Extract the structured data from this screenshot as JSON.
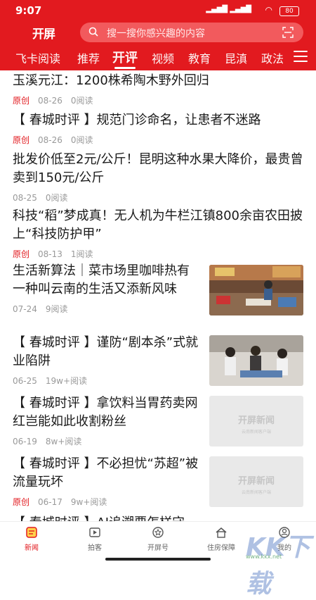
{
  "status": {
    "time": "9:07",
    "battery": "80"
  },
  "header": {
    "logo": "开屏",
    "search_placeholder": "搜一搜你感兴趣的内容"
  },
  "tabs": [
    "飞卡阅读",
    "推荐",
    "开评",
    "视频",
    "教育",
    "昆滇",
    "政法"
  ],
  "active_tab": "开评",
  "articles": [
    {
      "title": "玉溪元江：1200株希陶木野外回归",
      "tag": "原创",
      "date": "08-26",
      "reads": "0阅读"
    },
    {
      "title": "【 春城时评 】规范门诊命名，让患者不迷路",
      "tag": "原创",
      "date": "08-26",
      "reads": "0阅读"
    },
    {
      "title": "批发价低至2元/公斤！昆明这种水果大降价，最贵曾卖到150元/公斤",
      "tag": "",
      "date": "08-25",
      "reads": "0阅读"
    },
    {
      "title": "科技“稻”梦成真！无人机为牛栏江镇800余亩农田披上“科技防护甲”",
      "tag": "原创",
      "date": "08-13",
      "reads": "1阅读"
    },
    {
      "title": "生活新算法｜菜市场里咖啡热有一种叫云南的生活又添新风味",
      "tag": "",
      "date": "07-24",
      "reads": "9阅读",
      "thumb": "photo-market"
    },
    {
      "title": "【 春城时评 】谨防“剧本杀”式就业陷阱",
      "tag": "",
      "date": "06-25",
      "reads": "19w+阅读",
      "thumb": "photo-jobfair"
    },
    {
      "title": "【 春城时评 】拿饮料当胃药卖网红岂能如此收割粉丝",
      "tag": "",
      "date": "06-19",
      "reads": "8w+阅读",
      "thumb": "placeholder"
    },
    {
      "title": "【 春城时评 】不必担忧“苏超”被流量玩坏",
      "tag": "原创",
      "date": "06-17",
      "reads": "9w+阅读",
      "thumb": "placeholder"
    },
    {
      "title": "【 春城时评 】AI追溯要怎样守",
      "tag": "",
      "date": "",
      "reads": ""
    }
  ],
  "placeholder_brand": {
    "name": "开屏新闻",
    "slogan": "云南新闻客户端"
  },
  "bottom_nav": [
    "新闻",
    "拍客",
    "开屏号",
    "住房保障",
    "我的"
  ],
  "watermark": {
    "main": "KK下载",
    "url": "www.kkx.net"
  },
  "colors": {
    "brand_red": "#e21a1f"
  }
}
